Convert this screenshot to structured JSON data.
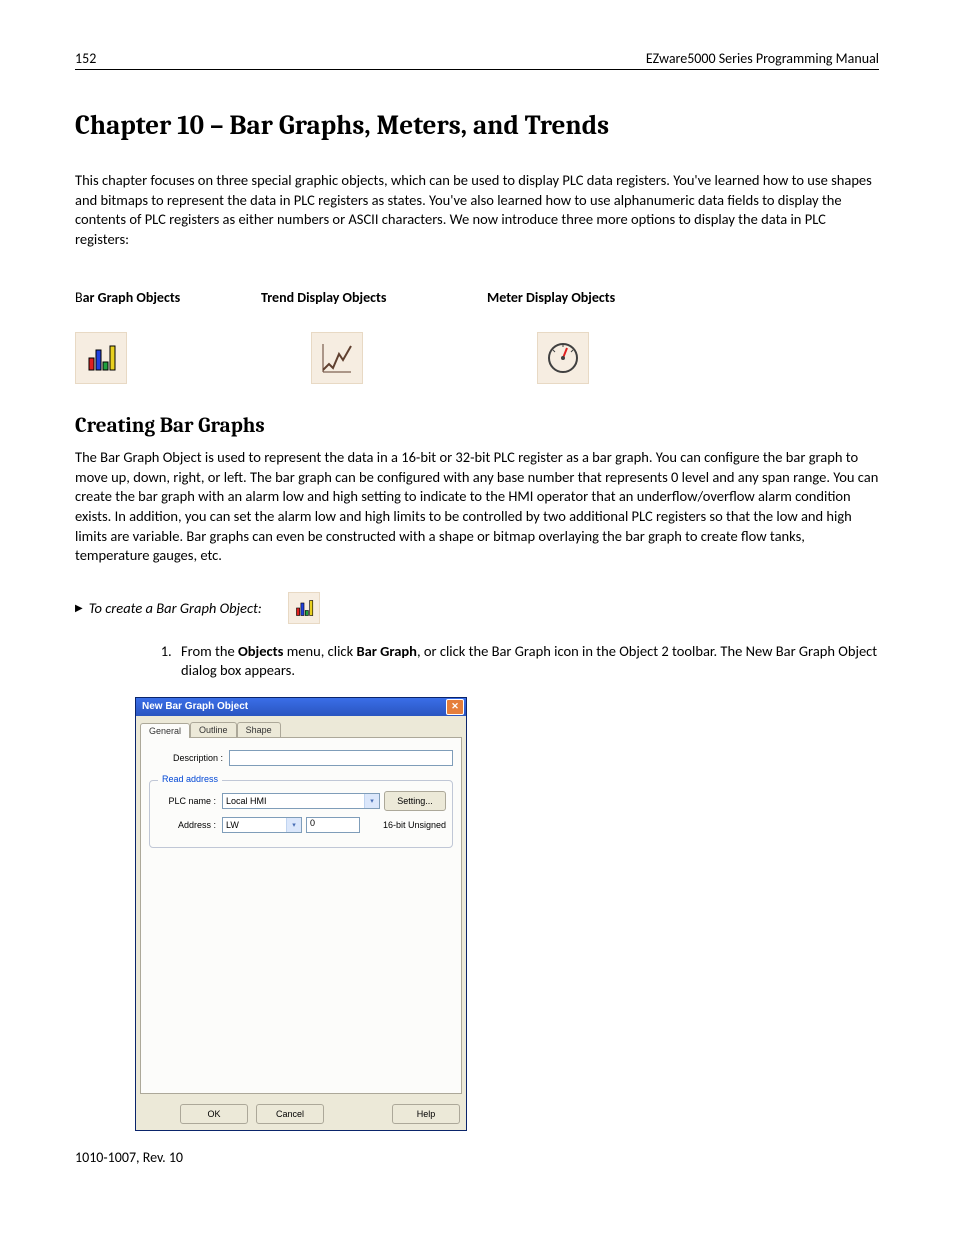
{
  "header": {
    "page_num": "152",
    "doc_title": "EZware5000 Series Programming Manual"
  },
  "chapter_title": "Chapter 10 – Bar Graphs, Meters, and Trends",
  "intro": "This chapter focuses on three special graphic objects, which can be used to display PLC data registers. You've learned how to use shapes and bitmaps to represent the data in PLC registers as states. You've also learned how to use alphanumeric data fields to display the contents of PLC registers as either numbers or ASCII characters. We now introduce three more options to display the data in PLC registers:",
  "objects": {
    "bar_first": "B",
    "bar_rest": "ar Graph Objects",
    "trend": "Trend Display Objects",
    "meter": "Meter Display Objects"
  },
  "section_title": "Creating Bar Graphs",
  "section_para": "The Bar Graph Object is used to represent the data in a 16-bit or 32-bit PLC register as a bar graph. You can configure the bar graph to move up, down, right, or left. The bar graph can be configured with any base number that represents 0 level and any span range. You can create the bar graph with an alarm low and high setting to indicate to the HMI operator that an underflow/overflow alarm condition exists. In addition, you can set the alarm low and high limits to be controlled by two additional PLC registers so that the low and high limits are variable. Bar graphs can even be constructed with a shape or bitmap overlaying the bar graph to create flow tanks, temperature gauges, etc.",
  "procedure_label": "To create a Bar Graph Object:",
  "step1": {
    "pre": "From the ",
    "b1": "Objects",
    "mid1": " menu, click ",
    "b2": "Bar Graph",
    "post": ", or click the Bar Graph icon in the Object 2 toolbar. The New Bar Graph Object dialog box appears."
  },
  "dialog": {
    "title": "New Bar Graph Object",
    "tabs": {
      "t1": "General",
      "t2": "Outline",
      "t3": "Shape"
    },
    "desc_label": "Description :",
    "desc_value": "",
    "readaddr_legend": "Read address",
    "plc_label": "PLC name :",
    "plc_value": "Local HMI",
    "settings_btn": "Setting...",
    "addr_label": "Address :",
    "addr_type": "LW",
    "addr_value": "0",
    "data_type": "16-bit Unsigned",
    "ok": "OK",
    "cancel": "Cancel",
    "help": "Help"
  },
  "footer_rev": "1010-1007, Rev. 10"
}
